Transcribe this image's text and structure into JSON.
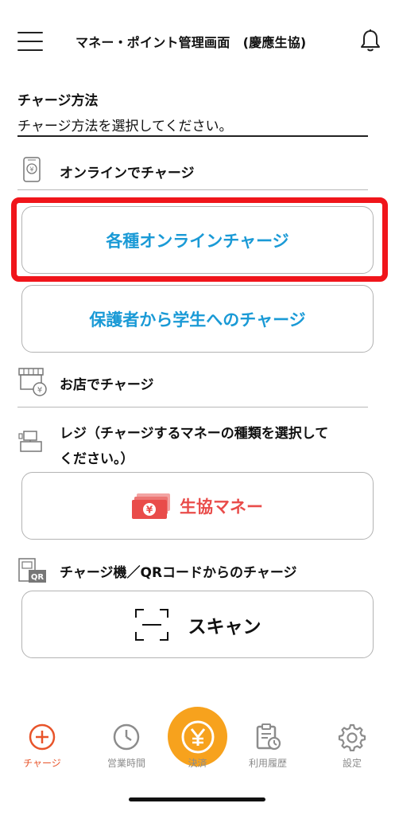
{
  "header": {
    "title": "マネー・ポイント管理画面　(慶應生協)"
  },
  "charge": {
    "section_title": "チャージ方法",
    "section_subtitle": "チャージ方法を選択してください。",
    "online_label": "オンラインでチャージ",
    "online_button": "各種オンラインチャージ",
    "guardian_button": "保護者から学生へのチャージ",
    "store_label": "お店でチャージ",
    "register_label_line1": "レジ（チャージするマネーの種類を選択して",
    "register_label_line2": "ください。）",
    "money_button": "生協マネー",
    "machine_label": "チャージ機／QRコードからのチャージ",
    "scan_button": "スキャン"
  },
  "tabbar": {
    "tabs": [
      {
        "label": "チャージ",
        "icon": "plus-circle-icon"
      },
      {
        "label": "営業時間",
        "icon": "clock-icon"
      },
      {
        "label": "決済",
        "icon": "yen-circle-icon"
      },
      {
        "label": "利用履歴",
        "icon": "clipboard-clock-icon"
      },
      {
        "label": "設定",
        "icon": "gear-icon"
      }
    ],
    "active_color": "#e8542a",
    "pay_color": "#f7a21d"
  },
  "colors": {
    "accent_blue": "#1a9ad6",
    "highlight_red": "#f0151b",
    "money_red": "#e94c4a"
  }
}
